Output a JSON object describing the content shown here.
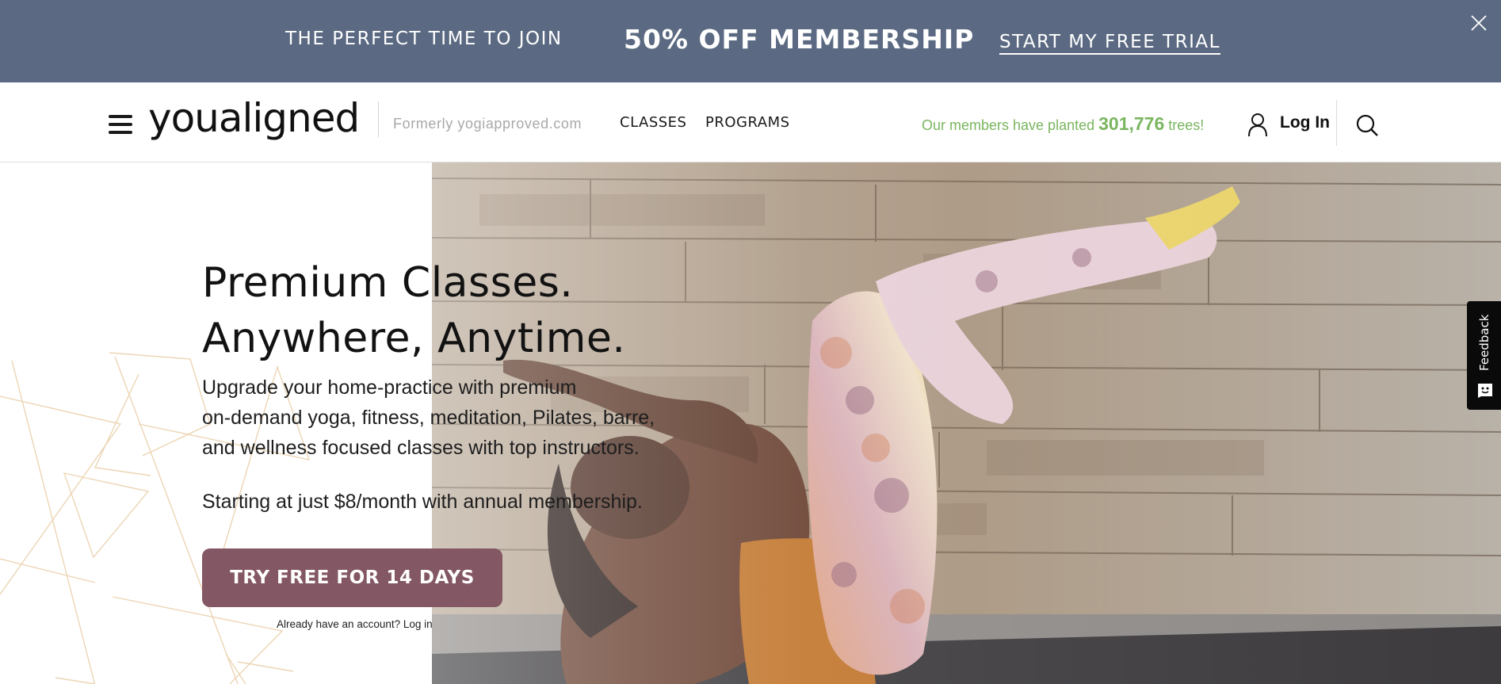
{
  "promo_banner": {
    "lead_text": "THE PERFECT TIME TO JOIN",
    "offer_text": "50% OFF MEMBERSHIP",
    "cta_label": "START MY FREE TRIAL",
    "close_icon": "close-x-icon",
    "background_color": "#5b6a82"
  },
  "header": {
    "menu_icon": "hamburger-menu-icon",
    "logo_text": "youaligned",
    "formerly_text": "Formerly yogiapproved.com",
    "nav": [
      {
        "label": "CLASSES"
      },
      {
        "label": "PROGRAMS"
      }
    ],
    "trees": {
      "prefix": "Our members have planted ",
      "count": "301,776",
      "suffix": " trees!",
      "color": "#7ab55f"
    },
    "login_icon": "user-icon",
    "login_label": "Log In",
    "search_icon": "search-icon"
  },
  "hero": {
    "headline_line1": "Premium Classes.",
    "headline_line2": "Anywhere, Anytime.",
    "body_line1": "Upgrade your home-practice with premium",
    "body_line2": "on-demand yoga, fitness, meditation, Pilates, barre,",
    "body_line3": "and wellness focused classes with top instructors.",
    "price_text": "Starting at just $8/month with annual membership.",
    "cta_label": "TRY FREE FOR 14 DAYS",
    "cta_color": "#835763",
    "login_prompt": "Already have an account? Log in",
    "image_description": "Woman in tie-dye leggings doing a yoga pose on a mat in front of a wood plank wall"
  },
  "feedback_tab": {
    "label": "Feedback",
    "icon": "smiley-chat-icon"
  }
}
